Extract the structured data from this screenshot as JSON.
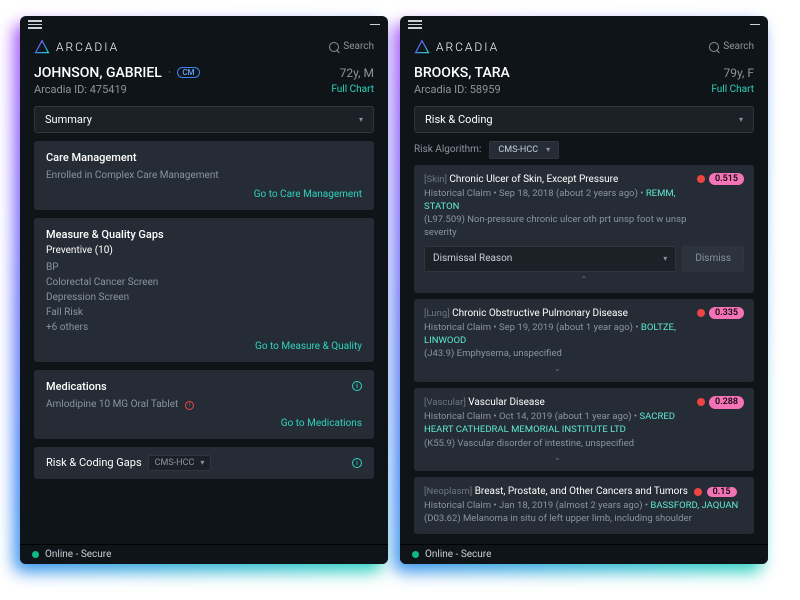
{
  "brand": "ARCADIA",
  "search_label": "Search",
  "status": "Online - Secure",
  "left": {
    "patient_name": "JOHNSON, GABRIEL",
    "cm_badge": "CM",
    "age_sex": "72y, M",
    "arcadia_id": "Arcadia ID: 475419",
    "full_chart": "Full Chart",
    "section_select": "Summary",
    "cards": {
      "care": {
        "title": "Care Management",
        "body": "Enrolled in Complex Care Management",
        "link": "Go to Care Management"
      },
      "quality": {
        "title": "Measure & Quality Gaps",
        "subtitle": "Preventive (10)",
        "items": [
          "BP",
          "Colorectal Cancer Screen",
          "Depression Screen",
          "Fall Risk",
          "+6 others"
        ],
        "link": "Go to Measure & Quality"
      },
      "meds": {
        "title": "Medications",
        "item": "Amlodipine 10 MG Oral Tablet",
        "link": "Go to Medications"
      },
      "coding": {
        "title": "Risk & Coding Gaps",
        "algo": "CMS-HCC"
      }
    }
  },
  "right": {
    "patient_name": "BROOKS, TARA",
    "age_sex": "79y, F",
    "arcadia_id": "Arcadia ID: 58959",
    "full_chart": "Full Chart",
    "section_select": "Risk & Coding",
    "risk_algo_label": "Risk Algorithm:",
    "risk_algo_value": "CMS-HCC",
    "dismissal_label": "Dismissal Reason",
    "dismiss_btn": "Dismiss",
    "items": [
      {
        "cat": "[Skin]",
        "title": "Chronic Ulcer of Skin, Except Pressure",
        "hist": "Historical Claim • Sep 18, 2018 (about 2 years ago) • ",
        "provider": "REMM, STATON",
        "desc": "(L97.509) Non-pressure chronic ulcer oth prt unsp foot w unsp severity",
        "score": "0.515",
        "expandable": true
      },
      {
        "cat": "[Lung]",
        "title": "Chronic Obstructive Pulmonary Disease",
        "hist": "Historical Claim • Sep 19, 2019 (about 1 year ago) • ",
        "provider": "BOLTZE, LINWOOD",
        "desc": "(J43.9) Emphysema, unspecified",
        "score": "0.335"
      },
      {
        "cat": "[Vascular]",
        "title": "Vascular Disease",
        "hist": "Historical Claim • Oct 14, 2019 (about 1 year ago) • ",
        "provider": "SACRED HEART CATHEDRAL MEMORIAL INSTITUTE LTD",
        "desc": "(K55.9) Vascular disorder of intestine, unspecified",
        "score": "0.288"
      },
      {
        "cat": "[Neoplasm]",
        "title": "Breast, Prostate, and Other Cancers and Tumors",
        "hist": "Historical Claim • Jan 18, 2019 (almost 2 years ago) • ",
        "provider": "BASSFORD, JAQUAN",
        "desc": "(D03.62) Melanoma in situ of left upper limb, including shoulder",
        "score": "0.15"
      }
    ]
  }
}
